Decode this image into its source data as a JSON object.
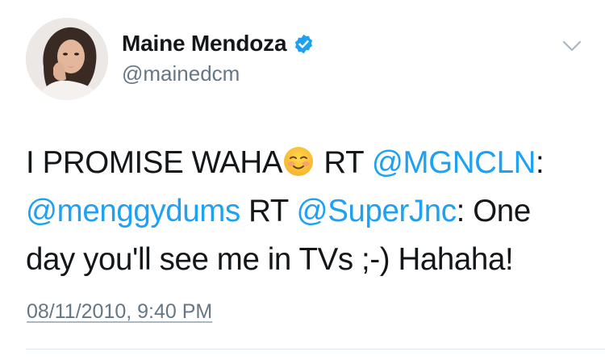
{
  "user": {
    "display_name": "Maine Mendoza",
    "handle": "@mainedcm",
    "verified": true
  },
  "tweet": {
    "line1": {
      "text_a": "I PROMISE WAHA",
      "emoji": "smiling-face-with-smiling-eyes",
      "text_b": " RT ",
      "mention": "@MGNCLN",
      "text_c": ":"
    },
    "line2": {
      "mention_a": "@menggydums",
      "text_a": " RT ",
      "mention_b": "@SuperJnc",
      "text_b": ": One"
    },
    "line3": {
      "text": "day you'll see me in TVs ;-) Hahaha!"
    }
  },
  "timestamp": "08/11/2010, 9:40 PM",
  "colors": {
    "mention": "#1da1f2",
    "secondary_text": "#657786",
    "verified": "#1da1f2"
  },
  "icons": {
    "verified": "verified-badge-icon",
    "menu": "chevron-down-icon",
    "emoji": "smiling-face-emoji"
  }
}
